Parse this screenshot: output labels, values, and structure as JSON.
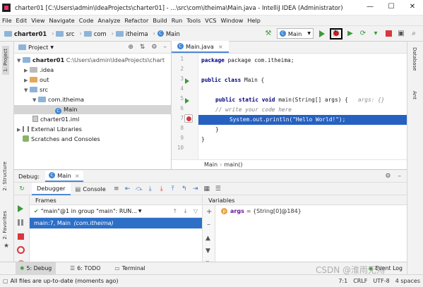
{
  "window": {
    "title": "charter01 [C:\\Users\\admin\\IdeaProjects\\charter01] - ...\\src\\com\\itheima\\Main.java - IntelliJ IDEA (Administrator)",
    "minimize": "—",
    "maximize": "☐",
    "close": "✕"
  },
  "menu": [
    "File",
    "Edit",
    "View",
    "Navigate",
    "Code",
    "Analyze",
    "Refactor",
    "Build",
    "Run",
    "Tools",
    "VCS",
    "Window",
    "Help"
  ],
  "nav": {
    "project": "charter01",
    "src": "src",
    "com": "com",
    "pkg": "itheima",
    "file": "Main",
    "run_config": "Main"
  },
  "left_tabs": {
    "project": "1: Project",
    "structure": "2: Structure",
    "favorites": "2: Favorites"
  },
  "right_tabs": {
    "database": "Database",
    "ant": "Ant"
  },
  "project_pane": {
    "title": "Project",
    "tree": [
      {
        "label": "charter01",
        "note": "C:\\Users\\admin\\IdeaProjects\\chart"
      },
      {
        "label": ".idea"
      },
      {
        "label": "out"
      },
      {
        "label": "src"
      },
      {
        "label": "com.itheima"
      },
      {
        "label": "Main"
      },
      {
        "label": "charter01.iml"
      },
      {
        "label": "External Libraries"
      },
      {
        "label": "Scratches and Consoles"
      }
    ]
  },
  "editor": {
    "tab": "Main.java",
    "line_numbers": [
      "1",
      "2",
      "3",
      "4",
      "5",
      "6",
      "7",
      "8",
      "9",
      "10"
    ],
    "lines": {
      "l1": "package com.itheima;",
      "l3a": "public class ",
      "l3b": "Main {",
      "l5a": "public static void ",
      "l5b": "main(String[] args) {",
      "l5c": "args: {}",
      "l6": "// write your code here",
      "l7": "System.out.println(\"Hello World!\");",
      "l8": "}",
      "l9": "}"
    },
    "breadcrumb": {
      "cls": "Main",
      "method": "main()"
    }
  },
  "debug": {
    "label": "Debug:",
    "config": "Main",
    "tabs": {
      "debugger": "Debugger",
      "console": "Console"
    },
    "frames_title": "Frames",
    "variables_title": "Variables",
    "thread": "\"main\"@1 in group \"main\": RUN...",
    "frame": "main:7, Main",
    "frame_pkg": "(com.itheima)",
    "var_name": "args",
    "var_value": "= {String[0]@184}"
  },
  "bottom_tabs": {
    "debug": "5: Debug",
    "todo": "6: TODO",
    "terminal": "Terminal",
    "eventlog": "Event Log"
  },
  "status": {
    "message": "All files are up-to-date (moments ago)",
    "pos": "7:1",
    "crlf": "CRLF",
    "enc": "UTF-8",
    "indent": "4 spaces"
  },
  "watermark": "CSDN @淮雨无殇",
  "colors": {
    "accent": "#2661c1",
    "selection": "#2d6fc7",
    "run_green": "#3a9a3a"
  }
}
